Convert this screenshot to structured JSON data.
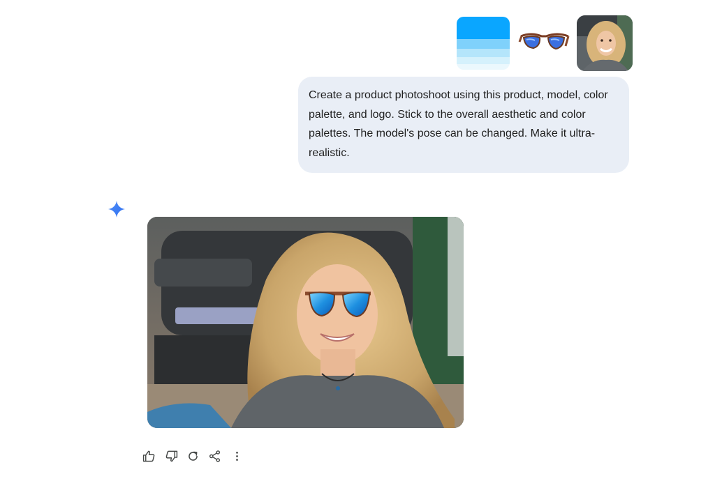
{
  "user_message": {
    "text": "Create a product photoshoot using this product, model, color palette, and logo. Stick to the overall aesthetic and color palettes. The model's pose can be changed. Make it ultra-realistic.",
    "attachments": [
      {
        "kind": "color-palette",
        "colors": [
          "#0aa6ff",
          "#7fd1fb",
          "#b4e5fb",
          "#d5f1fc",
          "#ebf8fd"
        ]
      },
      {
        "kind": "product-image",
        "subject": "sunglasses"
      },
      {
        "kind": "model-photo",
        "subject": "smiling woman"
      }
    ]
  },
  "assistant": {
    "avatar_icon": "gemini-spark-icon",
    "response_image": {
      "subject": "woman wearing blue mirrored sunglasses"
    }
  },
  "action_bar": {
    "icons": [
      "thumbs-up-icon",
      "thumbs-down-icon",
      "regenerate-icon",
      "share-icon",
      "more-vert-icon"
    ]
  },
  "colors": {
    "bubble_bg": "#e9eef6",
    "text": "#1f1f1f",
    "icon": "#444746",
    "spark_blue": "#4285f4"
  }
}
